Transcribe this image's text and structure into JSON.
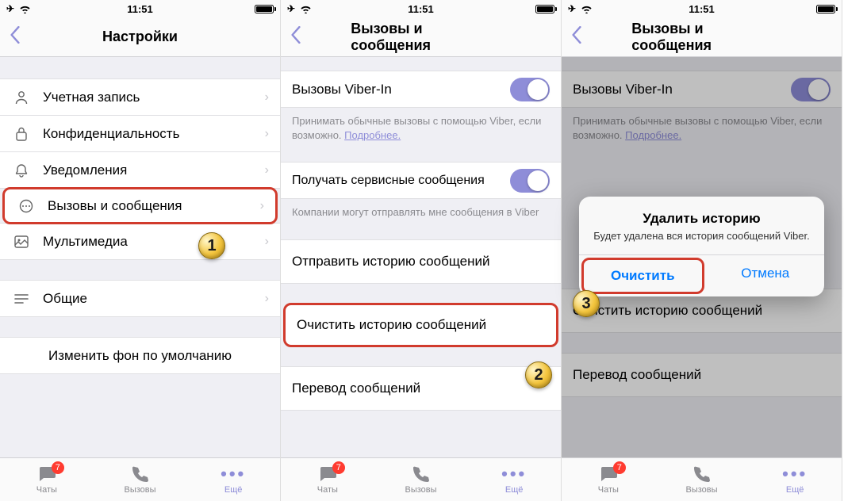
{
  "status": {
    "time": "11:51"
  },
  "panel1": {
    "title": "Настройки",
    "rows": {
      "account": "Учетная запись",
      "privacy": "Конфиденциальность",
      "notifications": "Уведомления",
      "calls_messages": "Вызовы и сообщения",
      "media": "Мультимедиа",
      "general": "Общие",
      "wallpaper": "Изменить фон по умолчанию"
    },
    "step": "1"
  },
  "panel2": {
    "title": "Вызовы и сообщения",
    "viber_in": "Вызовы Viber-In",
    "viber_in_note_a": "Принимать обычные вызовы с помощью Viber, если возможно. ",
    "viber_in_link": "Подробнее.",
    "service_msgs": "Получать сервисные сообщения",
    "service_note": "Компании могут отправлять мне сообщения в Viber",
    "send_history": "Отправить историю сообщений",
    "clear_history": "Очистить историю сообщений",
    "translate": "Перевод сообщений",
    "step": "2"
  },
  "panel3": {
    "title": "Вызовы и сообщения",
    "viber_in": "Вызовы Viber-In",
    "viber_in_note_a": "Принимать обычные вызовы с помощью Viber, если возможно. ",
    "viber_in_link": "Подробнее.",
    "clear_history": "Очистить историю сообщений",
    "translate": "Перевод сообщений",
    "dialog": {
      "title": "Удалить историю",
      "message": "Будет удалена вся история сообщений Viber.",
      "clear": "Очистить",
      "cancel": "Отмена"
    },
    "step": "3"
  },
  "tabs": {
    "chats": "Чаты",
    "calls": "Вызовы",
    "more": "Ещё",
    "badge": "7"
  }
}
